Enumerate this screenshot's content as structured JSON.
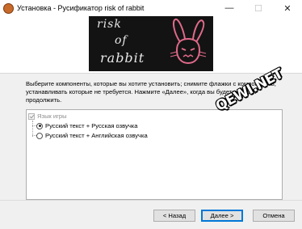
{
  "window": {
    "title": "Установка - Русификатор risk of rabbit",
    "minimize_glyph": "—",
    "maximize_glyph": "☐",
    "close_glyph": "✕"
  },
  "banner": {
    "line1": "risk",
    "line2": "of",
    "line3": "rabbit"
  },
  "description": "Выберите компоненты, которые вы хотите установить; снимите флажки с компонентов, устанавливать которые не требуется. Нажмите «Далее», когда вы будете готовы продолжить.",
  "components": {
    "group_label": "Язык игры",
    "options": [
      {
        "label": "Русский текст + Русская озвучка",
        "selected": true
      },
      {
        "label": "Русский текст + Английская озвучка",
        "selected": false
      }
    ]
  },
  "watermark": "QEWI.NET",
  "buttons": {
    "back": "< Назад",
    "next": "Далее >",
    "cancel": "Отмена"
  },
  "icons": [
    "app-icon",
    "checkbox-icon",
    "radio-icon",
    "bunny-icon"
  ]
}
